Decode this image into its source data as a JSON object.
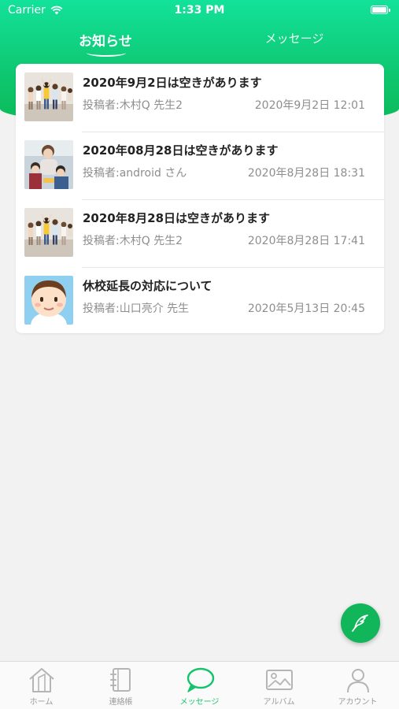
{
  "status_bar": {
    "carrier": "Carrier",
    "time": "1:33 PM"
  },
  "tabs": [
    {
      "label": "お知らせ",
      "active": true
    },
    {
      "label": "メッセージ",
      "active": false
    }
  ],
  "notices": [
    {
      "title": "2020年9月2日は空きがあります",
      "author": "投稿者:木村Q 先生2",
      "date": "2020年9月2日 12:01",
      "thumb": "kids-group-photo"
    },
    {
      "title": "2020年08月28日は空きがあります",
      "author": "投稿者:android さん",
      "date": "2020年8月28日 18:31",
      "thumb": "family-photo"
    },
    {
      "title": "2020年8月28日は空きがあります",
      "author": "投稿者:木村Q 先生2",
      "date": "2020年8月28日 17:41",
      "thumb": "kids-group-photo"
    },
    {
      "title": "休校延長の対応について",
      "author": "投稿者:山口亮介 先生",
      "date": "2020年5月13日 20:45",
      "thumb": "avatar-illustration"
    }
  ],
  "fab": {
    "icon": "quill-pen-icon"
  },
  "tabbar": [
    {
      "label": "ホーム",
      "icon": "home-icon",
      "active": false
    },
    {
      "label": "連絡帳",
      "icon": "notebook-icon",
      "active": false
    },
    {
      "label": "メッセージ",
      "icon": "chat-bubble-icon",
      "active": true
    },
    {
      "label": "アルバム",
      "icon": "photo-album-icon",
      "active": false
    },
    {
      "label": "アカウント",
      "icon": "person-icon",
      "active": false
    }
  ],
  "colors": {
    "accent": "#14c46c",
    "header_top": "#12e29a",
    "header_bottom": "#0cba58"
  }
}
